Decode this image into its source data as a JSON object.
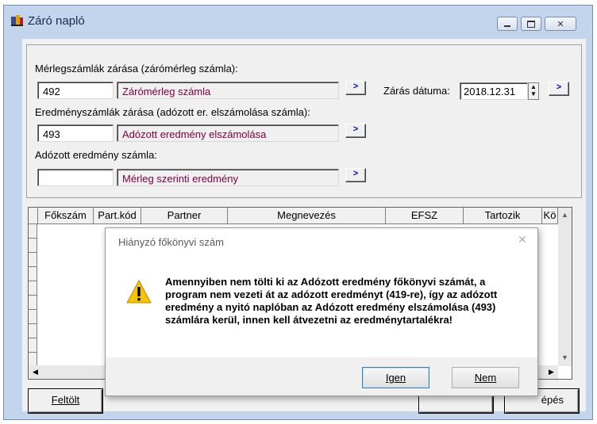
{
  "window": {
    "title": "Záró napló",
    "min_glyph": "▭",
    "max_glyph": "□",
    "close_glyph": "✕"
  },
  "form": {
    "balance_label": "Mérlegszámlák zárása (zárómérleg számla):",
    "balance_code": "492",
    "balance_name": "Zárómérleg számla",
    "result_label": "Eredményszámlák zárása (adózott er. elszámolása számla):",
    "result_code": "493",
    "result_name": "Adózott eredmény elszámolása",
    "taxed_label": "Adózott eredmény számla:",
    "taxed_code": "",
    "taxed_name": "Mérleg szerinti eredmény",
    "arrow_label": ">",
    "date_label": "Zárás dátuma:",
    "date_value": "2018.12.31"
  },
  "grid": {
    "columns": [
      "Főkszám",
      "Part.kód",
      "Partner",
      "Megnevezés",
      "EFSZ",
      "Tartozik",
      "Kö"
    ]
  },
  "buttons": {
    "fill": "Feltölt",
    "right_partial": "épés"
  },
  "dialog": {
    "title": "Hiányzó főkönyvi szám",
    "close_glyph": "✕",
    "message": "Amennyiben nem tölti ki az Adózott eredmény főkönyvi számát, a program nem vezeti át az adózott eredményt (419-re), így az adózott eredmény a nyitó naplóban az Adózott eredmény elszámolása (493) számlára kerül, innen kell átvezetni az eredménytartalékra!",
    "yes": "Igen",
    "no": "Nem"
  },
  "colors": {
    "readonly_text": "#800040",
    "arrow_text": "#0000c8",
    "window_frame": "#c3d5ec"
  }
}
